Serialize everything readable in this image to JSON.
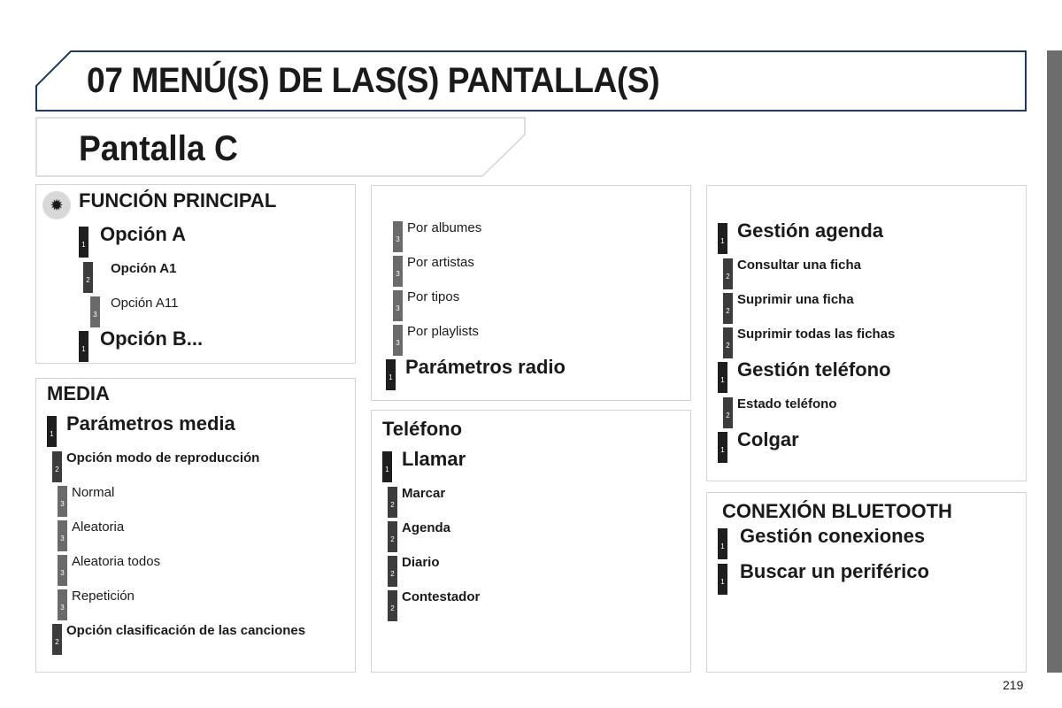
{
  "header": {
    "title": "07  MENÚ(S) DE LAS(S) PANTALLA(S)",
    "subtitle": "Pantalla C"
  },
  "panels": [
    {
      "id": "p1",
      "heading": "FUNCIÓN PRINCIPAL",
      "icon": "settings-sun-icon",
      "items": [
        {
          "level": 1,
          "text": "Opción A"
        },
        {
          "level": 2,
          "text": "Opción A1"
        },
        {
          "level": 3,
          "text": "Opción A11"
        },
        {
          "level": 1,
          "text": "Opción B..."
        }
      ]
    },
    {
      "id": "p2",
      "heading": "MEDIA",
      "items": [
        {
          "level": 1,
          "text": "Parámetros media"
        },
        {
          "level": 2,
          "text": "Opción modo de reproducción"
        },
        {
          "level": 3,
          "text": "Normal"
        },
        {
          "level": 3,
          "text": "Aleatoria"
        },
        {
          "level": 3,
          "text": "Aleatoria todos"
        },
        {
          "level": 3,
          "text": "Repetición"
        },
        {
          "level": 2,
          "text": "Opción clasificación de las canciones"
        }
      ]
    },
    {
      "id": "p3",
      "heading": "",
      "items": [
        {
          "level": 3,
          "text": "Por albumes"
        },
        {
          "level": 3,
          "text": "Por artistas"
        },
        {
          "level": 3,
          "text": "Por tipos"
        },
        {
          "level": 3,
          "text": "Por playlists"
        },
        {
          "level": 1,
          "text": "Parámetros radio"
        }
      ]
    },
    {
      "id": "p4",
      "heading": "Teléfono",
      "items": [
        {
          "level": 1,
          "text": "Llamar"
        },
        {
          "level": 2,
          "text": "Marcar"
        },
        {
          "level": 2,
          "text": "Agenda"
        },
        {
          "level": 2,
          "text": "Diario"
        },
        {
          "level": 2,
          "text": "Contestador"
        }
      ]
    },
    {
      "id": "p5",
      "heading": "",
      "items": [
        {
          "level": 1,
          "text": "Gestión agenda"
        },
        {
          "level": 2,
          "text": "Consultar una ficha"
        },
        {
          "level": 2,
          "text": "Suprimir una ficha"
        },
        {
          "level": 2,
          "text": "Suprimir todas las fichas"
        },
        {
          "level": 1,
          "text": "Gestión teléfono"
        },
        {
          "level": 2,
          "text": "Estado teléfono"
        },
        {
          "level": 1,
          "text": "Colgar"
        }
      ]
    },
    {
      "id": "p6",
      "heading": "CONEXIÓN BLUETOOTH",
      "items": [
        {
          "level": 1,
          "text": "Gestión conexiones"
        },
        {
          "level": 1,
          "text": "Buscar un periférico"
        }
      ]
    }
  ],
  "page_number": "219",
  "colors": {
    "title_border": "#1f3a5f",
    "panel_border": "#d4d4d4",
    "side_tab": "#6d6d6d"
  }
}
